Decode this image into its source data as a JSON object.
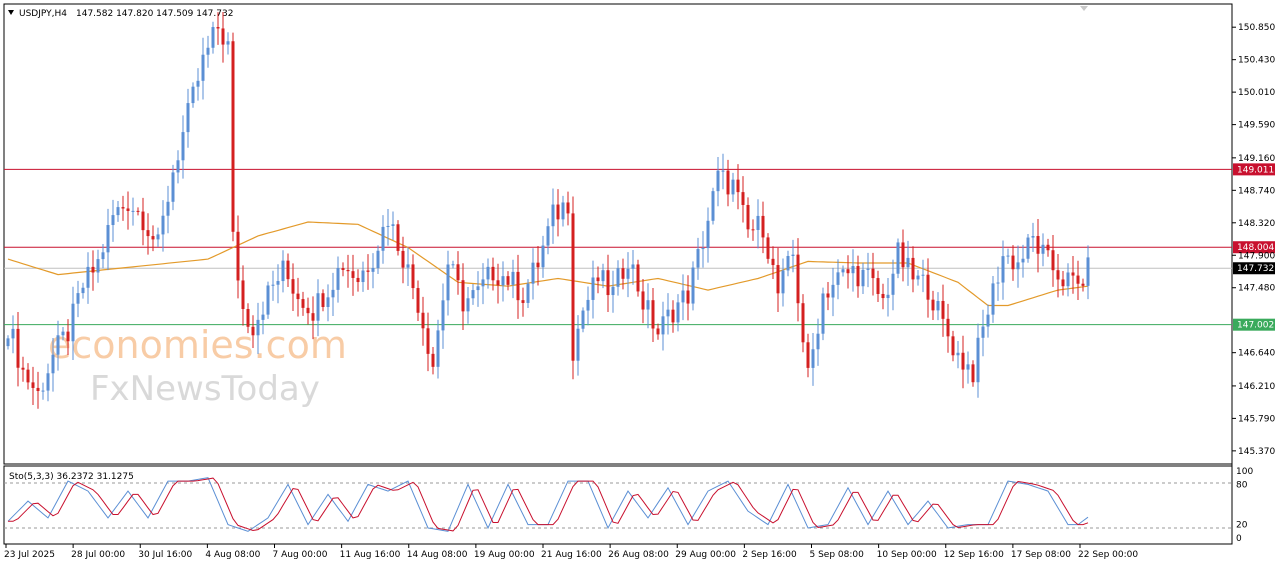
{
  "header": {
    "symbol_tf": "USDJPY,H4",
    "ohlc": "147.582 147.820 147.509 147.732"
  },
  "watermark": {
    "line1": "economies.com",
    "line2": "FxNewsToday"
  },
  "stoch_header": "Sto(5,3,3) 36.2372 31.1275",
  "price_axis_labels": [
    "150.850",
    "150.430",
    "150.010",
    "149.590",
    "149.160",
    "148.740",
    "148.320",
    "147.900",
    "147.480",
    "146.640",
    "146.210",
    "145.790",
    "145.370"
  ],
  "stoch_axis_labels": [
    "100",
    "80",
    "20",
    "0"
  ],
  "time_labels": [
    "23 Jul 2025",
    "28 Jul 00:00",
    "30 Jul 16:00",
    "4 Aug 08:00",
    "7 Aug 00:00",
    "11 Aug 16:00",
    "14 Aug 08:00",
    "19 Aug 00:00",
    "21 Aug 16:00",
    "26 Aug 08:00",
    "29 Aug 00:00",
    "2 Sep 16:00",
    "5 Sep 08:00",
    "10 Sep 00:00",
    "12 Sep 16:00",
    "17 Sep 08:00",
    "22 Sep 00:00"
  ],
  "colors": {
    "bull": "#5b8fd4",
    "bear": "#d42020",
    "ma": "#e39a2a",
    "resistance": "#c8102e",
    "support": "#3aaa5c",
    "current": "#000000",
    "stoch_main": "#5b8fd4",
    "stoch_signal": "#c8102e"
  },
  "chart_data": {
    "type": "candlestick",
    "symbol": "USDJPY",
    "timeframe": "H4",
    "ylim": [
      145.2,
      151.15
    ],
    "horizontal_levels": [
      {
        "value": 149.011,
        "label": "149.011",
        "color": "#c8102e"
      },
      {
        "value": 148.004,
        "label": "148.004",
        "color": "#c8102e"
      },
      {
        "value": 147.732,
        "label": "147.732",
        "color": "#000000"
      },
      {
        "value": 147.002,
        "label": "147.002",
        "color": "#3aaa5c"
      }
    ],
    "close_anchors": [
      [
        0,
        147.0
      ],
      [
        3,
        146.4
      ],
      [
        6,
        146.1
      ],
      [
        9,
        146.6
      ],
      [
        12,
        146.9
      ],
      [
        15,
        147.5
      ],
      [
        18,
        147.8
      ],
      [
        21,
        148.4
      ],
      [
        24,
        148.6
      ],
      [
        27,
        148.4
      ],
      [
        30,
        148.0
      ],
      [
        33,
        149.0
      ],
      [
        36,
        149.7
      ],
      [
        39,
        150.4
      ],
      [
        42,
        150.85
      ],
      [
        44,
        150.6
      ],
      [
        45,
        148.1
      ],
      [
        47,
        147.2
      ],
      [
        49,
        147.0
      ],
      [
        52,
        147.4
      ],
      [
        55,
        147.7
      ],
      [
        58,
        147.4
      ],
      [
        61,
        147.2
      ],
      [
        64,
        147.5
      ],
      [
        67,
        147.8
      ],
      [
        70,
        147.6
      ],
      [
        73,
        147.9
      ],
      [
        76,
        148.4
      ],
      [
        79,
        147.9
      ],
      [
        82,
        147.3
      ],
      [
        85,
        146.5
      ],
      [
        88,
        147.8
      ],
      [
        91,
        147.3
      ],
      [
        94,
        147.4
      ],
      [
        97,
        147.7
      ],
      [
        100,
        147.6
      ],
      [
        103,
        147.4
      ],
      [
        106,
        147.8
      ],
      [
        109,
        148.4
      ],
      [
        112,
        148.6
      ],
      [
        113,
        146.7
      ],
      [
        115,
        147.2
      ],
      [
        118,
        147.6
      ],
      [
        121,
        147.4
      ],
      [
        124,
        147.9
      ],
      [
        127,
        147.3
      ],
      [
        130,
        146.9
      ],
      [
        133,
        147.2
      ],
      [
        136,
        147.4
      ],
      [
        139,
        148.1
      ],
      [
        142,
        148.9
      ],
      [
        145,
        148.8
      ],
      [
        148,
        148.2
      ],
      [
        151,
        148.3
      ],
      [
        154,
        147.4
      ],
      [
        157,
        147.9
      ],
      [
        160,
        146.3
      ],
      [
        163,
        147.4
      ],
      [
        166,
        147.6
      ],
      [
        169,
        147.7
      ],
      [
        172,
        147.6
      ],
      [
        175,
        147.3
      ],
      [
        178,
        147.9
      ],
      [
        181,
        147.6
      ],
      [
        184,
        147.5
      ],
      [
        187,
        147.0
      ],
      [
        190,
        146.6
      ],
      [
        193,
        146.4
      ],
      [
        196,
        147.2
      ],
      [
        199,
        147.9
      ],
      [
        202,
        147.8
      ],
      [
        205,
        148.1
      ],
      [
        208,
        147.8
      ],
      [
        211,
        147.6
      ],
      [
        214,
        147.5
      ],
      [
        216,
        147.7
      ]
    ],
    "ma_anchors": [
      [
        0,
        147.85
      ],
      [
        10,
        147.65
      ],
      [
        25,
        147.75
      ],
      [
        40,
        147.85
      ],
      [
        50,
        148.15
      ],
      [
        60,
        148.33
      ],
      [
        70,
        148.3
      ],
      [
        80,
        148.0
      ],
      [
        90,
        147.55
      ],
      [
        100,
        147.5
      ],
      [
        110,
        147.6
      ],
      [
        120,
        147.5
      ],
      [
        130,
        147.6
      ],
      [
        140,
        147.45
      ],
      [
        150,
        147.6
      ],
      [
        160,
        147.82
      ],
      [
        170,
        147.8
      ],
      [
        180,
        147.8
      ],
      [
        190,
        147.55
      ],
      [
        196,
        147.25
      ],
      [
        200,
        147.25
      ],
      [
        210,
        147.45
      ],
      [
        216,
        147.5
      ]
    ],
    "stoch_anchors": [
      [
        0,
        25
      ],
      [
        4,
        55
      ],
      [
        8,
        30
      ],
      [
        12,
        85
      ],
      [
        16,
        70
      ],
      [
        20,
        30
      ],
      [
        24,
        70
      ],
      [
        28,
        30
      ],
      [
        32,
        85
      ],
      [
        36,
        85
      ],
      [
        40,
        90
      ],
      [
        44,
        20
      ],
      [
        48,
        10
      ],
      [
        52,
        30
      ],
      [
        56,
        80
      ],
      [
        60,
        20
      ],
      [
        64,
        65
      ],
      [
        68,
        25
      ],
      [
        72,
        80
      ],
      [
        76,
        70
      ],
      [
        80,
        85
      ],
      [
        84,
        15
      ],
      [
        88,
        10
      ],
      [
        92,
        80
      ],
      [
        96,
        15
      ],
      [
        100,
        80
      ],
      [
        104,
        20
      ],
      [
        108,
        20
      ],
      [
        112,
        85
      ],
      [
        116,
        85
      ],
      [
        120,
        15
      ],
      [
        124,
        70
      ],
      [
        128,
        30
      ],
      [
        132,
        75
      ],
      [
        136,
        20
      ],
      [
        140,
        70
      ],
      [
        144,
        85
      ],
      [
        148,
        40
      ],
      [
        152,
        20
      ],
      [
        156,
        80
      ],
      [
        160,
        15
      ],
      [
        164,
        20
      ],
      [
        168,
        75
      ],
      [
        172,
        20
      ],
      [
        176,
        70
      ],
      [
        180,
        20
      ],
      [
        184,
        55
      ],
      [
        188,
        15
      ],
      [
        192,
        20
      ],
      [
        196,
        20
      ],
      [
        200,
        85
      ],
      [
        204,
        80
      ],
      [
        208,
        70
      ],
      [
        212,
        20
      ],
      [
        214,
        20
      ],
      [
        216,
        31
      ]
    ]
  }
}
